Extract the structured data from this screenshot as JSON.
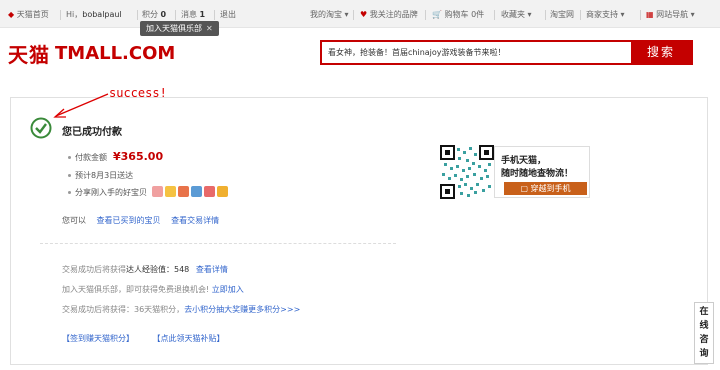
{
  "topbar": {
    "home": "天猫首页",
    "greeting": "Hi，",
    "username": "bobalpaul",
    "points_label": "积分",
    "points_value": "0",
    "messages_label": "消息",
    "messages_value": "1",
    "logout": "退出",
    "my_taobao": "我的淘宝",
    "brands": "我关注的品牌",
    "cart_label": "购物车",
    "cart_count": "0",
    "cart_unit": "件",
    "favorites": "收藏夹",
    "taobao": "淘宝网",
    "merchant": "商家支持",
    "site_nav": "网站导航",
    "tooltip": "加入天猫俱乐部",
    "tooltip_close": "✕"
  },
  "header": {
    "logo_cn": "天猫",
    "logo_en": "TMALL.COM",
    "search_value": "看女神，抢装备！首届chinajoy游戏装备节来啦！",
    "search_button": "搜索"
  },
  "annotation": "success!",
  "order": {
    "title": "您已成功付款",
    "amount_label": "付款金额",
    "amount": "¥365.00",
    "delivery": "预计8月3日送达",
    "share_label": "分享刚入手的好宝贝",
    "you_can": "您可以",
    "view_bought": "查看已买到的宝贝",
    "view_detail": "查看交易详情"
  },
  "rewards": {
    "exp_label": "交易成功后将获得",
    "exp_text": "达人经验值：548",
    "exp_link": "查看详情",
    "club_text": "加入天猫俱乐部，即可获得免费退换机会!",
    "club_link": "立即加入",
    "points_text": "交易成功后将获得：36天猫积分，",
    "points_link": "去小积分抽大奖赚更多积分>>>",
    "checkin": "【签到赚天猫积分】",
    "subsidy": "【点此领天猫补贴】"
  },
  "promo": {
    "line1": "手机天猫，",
    "line2": "随时随地查物流！",
    "button": "穿越到手机"
  },
  "consult": [
    "在",
    "线",
    "咨",
    "询"
  ],
  "colors": {
    "brand_red": "#c40000",
    "success_green": "#3a8a3a",
    "link_blue": "#3366cc",
    "promo_orange": "#c8601a"
  }
}
